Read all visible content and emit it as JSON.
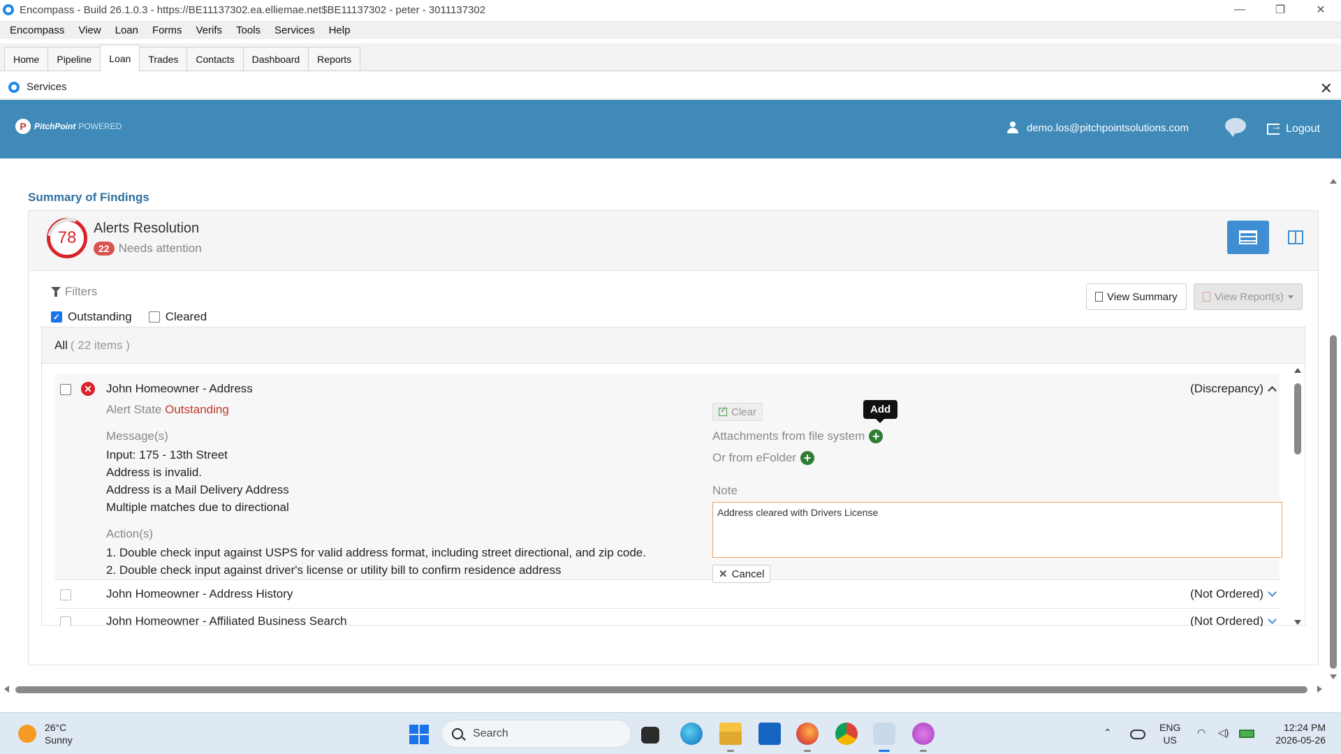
{
  "window": {
    "title": "Encompass - Build 26.1.0.3 - https://BE11137302.ea.elliemae.net$BE11137302 - peter - 3011137302",
    "minimize": "—",
    "restore": "❐",
    "close": "✕"
  },
  "menu": [
    "Encompass",
    "View",
    "Loan",
    "Forms",
    "Verifs",
    "Tools",
    "Services",
    "Help"
  ],
  "module_tabs": [
    "Home",
    "Pipeline",
    "Loan",
    "Trades",
    "Contacts",
    "Dashboard",
    "Reports"
  ],
  "active_tab": "Loan",
  "services_window": {
    "title": "Services",
    "close": "✕"
  },
  "banner": {
    "logo_mark": "P",
    "brand": "PitchPoint",
    "powered": "POWERED",
    "user_email": "demo.los@pitchpointsolutions.com",
    "logout": "Logout"
  },
  "summary": {
    "title": "Summary of Findings",
    "score": "78",
    "alerts_title": "Alerts Resolution",
    "needs_count": "22",
    "needs_text": "Needs attention"
  },
  "filters": {
    "label": "Filters",
    "outstanding": "Outstanding",
    "cleared": "Cleared",
    "outstanding_checked": true,
    "cleared_checked": false
  },
  "buttons": {
    "view_summary": "View Summary",
    "view_reports": "View Report(s)"
  },
  "list": {
    "all_label": "All",
    "count_label": "( 22 items )",
    "items": [
      {
        "title": "John Homeowner - Address",
        "status": "(Discrepancy)",
        "alert_state_label": "Alert State",
        "alert_state": "Outstanding",
        "messages_label": "Message(s)",
        "messages": [
          "Input: 175 - 13th Street",
          "Address is invalid.",
          "Address is a Mail Delivery Address",
          "Multiple matches due to directional"
        ],
        "actions_label": "Action(s)",
        "actions": [
          "1. Double check input against USPS for valid address format, including street directional, and zip code.",
          "2. Double check input against driver's license or utility bill to confirm residence address"
        ],
        "clear_label": "Clear",
        "tooltip": "Add",
        "attachments_label": "Attachments from file system",
        "efolder_label": "Or from eFolder",
        "note_label": "Note",
        "note_value": "Address cleared with Drivers License",
        "cancel_label": "Cancel"
      },
      {
        "title": "John Homeowner - Address History",
        "status": "(Not Ordered)"
      },
      {
        "title": "John Homeowner - Affiliated Business Search",
        "status": "(Not Ordered)"
      }
    ]
  },
  "taskbar": {
    "temperature": "26°C",
    "weather": "Sunny",
    "search": "Search",
    "lang_top": "ENG",
    "lang_bottom": "US",
    "time": "12:24 PM",
    "date": "2026-05-26"
  },
  "colors": {
    "banner": "#3f8ab9",
    "accent": "#3f8ed4",
    "alert_red": "#d9232a",
    "section_title": "#2e6f9e"
  }
}
